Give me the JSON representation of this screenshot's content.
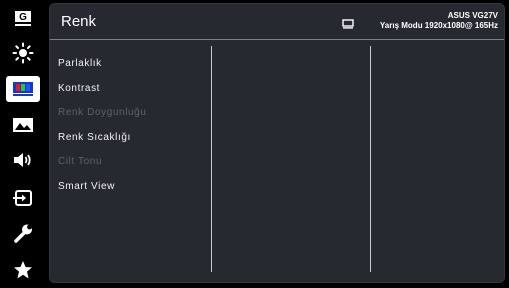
{
  "sidebar": {
    "items": [
      {
        "name": "gameplus-icon",
        "label": "G"
      },
      {
        "name": "brightness-icon"
      },
      {
        "name": "color-icon",
        "active": true
      },
      {
        "name": "image-icon"
      },
      {
        "name": "sound-icon"
      },
      {
        "name": "input-select-icon"
      },
      {
        "name": "system-setup-icon"
      },
      {
        "name": "favorite-star-icon"
      }
    ]
  },
  "header": {
    "title": "Renk",
    "model": "ASUS  VG27V",
    "mode": "Yarış Modu 1920x1080@ 165Hz"
  },
  "menu": {
    "items": [
      {
        "label": "Parlaklık",
        "enabled": true
      },
      {
        "label": "Kontrast",
        "enabled": true
      },
      {
        "label": "Renk Doygunluğu",
        "enabled": false
      },
      {
        "label": "Renk Sıcaklığı",
        "enabled": true
      },
      {
        "label": "Cilt Tonu",
        "enabled": false
      },
      {
        "label": "Smart View",
        "enabled": true
      }
    ]
  },
  "colors": {
    "panel_bg": "#262a30",
    "active_icon_bg": "#ffffff",
    "disabled_text": "#5d6168"
  }
}
